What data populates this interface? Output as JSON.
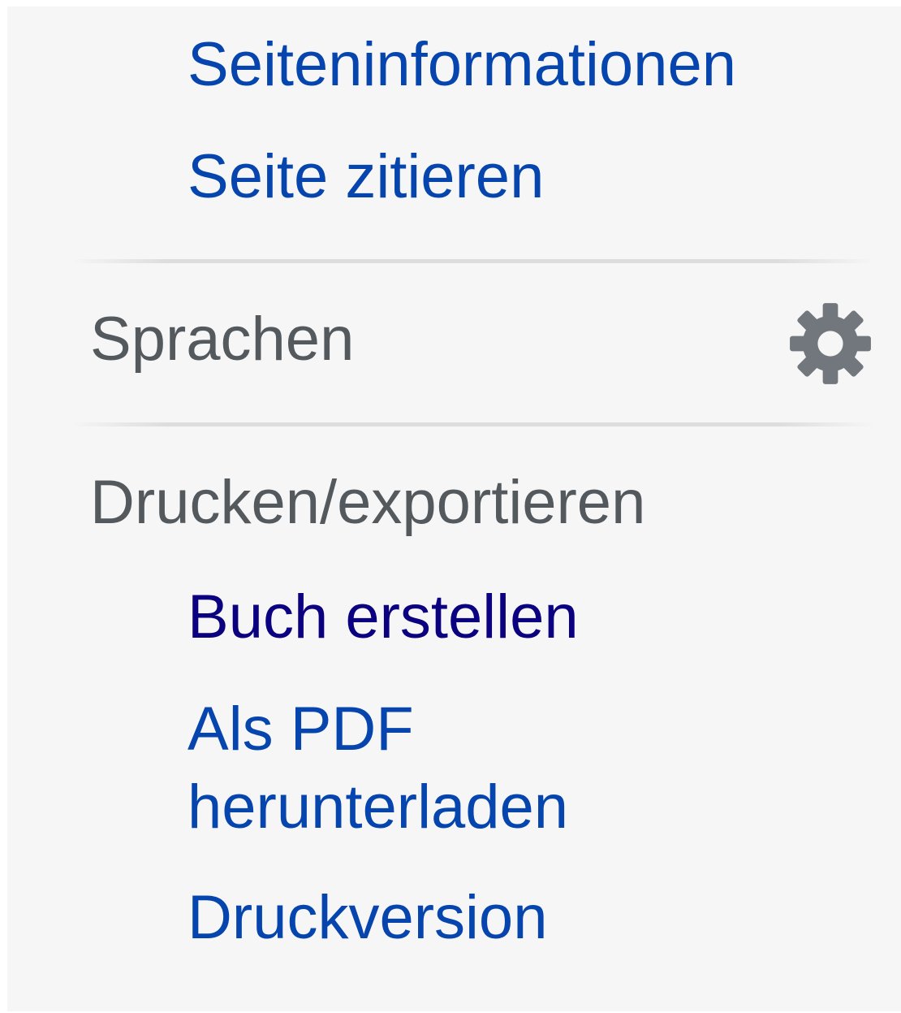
{
  "portlet_tools": {
    "items": [
      {
        "label": "Seiteninformationen"
      },
      {
        "label": "Seite zitieren"
      }
    ]
  },
  "languages": {
    "heading": "Sprachen",
    "settings_icon": "gear-icon"
  },
  "print_export": {
    "heading": "Drucken/exportieren",
    "items": [
      {
        "label": "Buch erstellen",
        "visited": true
      },
      {
        "label": "Als PDF herunterladen",
        "line1": "Als PDF",
        "line2": "herunterladen"
      },
      {
        "label": "Druckversion"
      }
    ]
  },
  "colors": {
    "panel_background": "#f6f6f6",
    "link": "#0645ad",
    "link_visited": "#0b0080",
    "heading": "#54595d",
    "icon": "#72777d"
  }
}
